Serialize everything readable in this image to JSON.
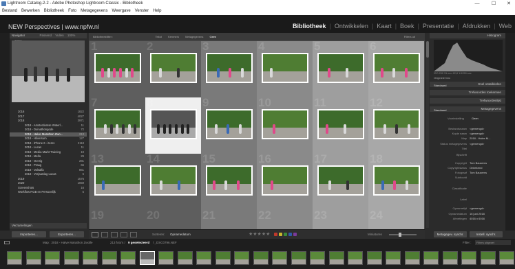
{
  "window": {
    "title": "Lightroom Catalog-2-2 - Adobe Photoshop Lightroom Classic - Bibliotheek",
    "minimize": "—",
    "maximize": "☐",
    "close": "✕"
  },
  "menu": [
    "Bestand",
    "Bewerken",
    "Bibliotheek",
    "Foto",
    "Metagegevens",
    "Weergave",
    "Venster",
    "Help"
  ],
  "identity_plate": "NEW Perspectives | www.npfw.nl",
  "modules": [
    {
      "label": "Bibliotheek",
      "selected": true
    },
    {
      "label": "Ontwikkelen",
      "selected": false
    },
    {
      "label": "Kaart",
      "selected": false
    },
    {
      "label": "Boek",
      "selected": false
    },
    {
      "label": "Presentatie",
      "selected": false
    },
    {
      "label": "Afdrukken",
      "selected": false
    },
    {
      "label": "Web",
      "selected": false
    }
  ],
  "left_panel": {
    "navigator": {
      "title": "Navigator",
      "zoom": [
        "Passend",
        "Vullen",
        "100%",
        "300%"
      ]
    },
    "folders": [
      {
        "label": "2016",
        "count": "1822"
      },
      {
        "label": "2017",
        "count": "4027"
      },
      {
        "label": "2018",
        "count": "3971"
      },
      {
        "label": "2018 - Amsterdamse Waterl...",
        "count": "11"
      },
      {
        "label": "2018 - Duinathongode",
        "count": "72"
      },
      {
        "label": "2018 - Halve Marathon Zwo...",
        "count": "213",
        "selected": true
      },
      {
        "label": "2018 - Hilversum",
        "count": "127"
      },
      {
        "label": "2018 - iPhone 6 - items",
        "count": "2118"
      },
      {
        "label": "2018 - Lucas",
        "count": "11"
      },
      {
        "label": "2018 - Media Markt Training",
        "count": "19"
      },
      {
        "label": "2018 - Mella",
        "count": "29"
      },
      {
        "label": "2018 - Overig",
        "count": "281"
      },
      {
        "label": "2018 - Praag",
        "count": "66"
      },
      {
        "label": "2018 - Valsalfa",
        "count": "861"
      },
      {
        "label": "2018 - Verjaardag Lucas",
        "count": "6"
      },
      {
        "label": "2019",
        "count": "1576"
      },
      {
        "label": "2020",
        "count": "1059"
      },
      {
        "label": "Screenshots",
        "count": "16"
      },
      {
        "label": "Workflow RGB en Persoonlijk",
        "count": "5"
      }
    ],
    "collections_header": "Verzamelingen",
    "import_button": "Importeren...",
    "export_button": "Exporteren..."
  },
  "filter_bar": {
    "label": "Bibliotheekfilter :",
    "tabs": [
      "Tekst",
      "Kenmerk",
      "Metagegevens",
      "Geen"
    ],
    "preset": "Filters uit"
  },
  "grid": {
    "cells": [
      {
        "n": "1"
      },
      {
        "n": "2"
      },
      {
        "n": "3"
      },
      {
        "n": "4"
      },
      {
        "n": "5"
      },
      {
        "n": "6"
      },
      {
        "n": "7"
      },
      {
        "n": "8"
      },
      {
        "n": "9"
      },
      {
        "n": "10"
      },
      {
        "n": "11"
      },
      {
        "n": "12"
      },
      {
        "n": "13"
      },
      {
        "n": "14"
      },
      {
        "n": "15"
      },
      {
        "n": "16"
      },
      {
        "n": "17"
      },
      {
        "n": "18"
      },
      {
        "n": "19"
      },
      {
        "n": "20"
      },
      {
        "n": "21"
      },
      {
        "n": "22"
      },
      {
        "n": "23"
      },
      {
        "n": "24"
      }
    ]
  },
  "toolbar": {
    "sort_label": "Sorteren:",
    "sort_value": "Opnamedatum",
    "stars": "★★★★★",
    "thumbnails_label": "Miniaturen"
  },
  "right_panel": {
    "histogram_title": "Histogram",
    "histogram_info": "ISO 200   31 mm   f/2,8   1/1250 sec",
    "original_photo": "Originele foto",
    "quick_develop": "Snel ontwikkelen",
    "saved_preset": "Standaard",
    "keywording": "Trefwoorden toekennen",
    "keyword_list": "Trefwoordenlijst",
    "metadata_title": "Metagegevens",
    "metadata_preset": "Standaard",
    "preset_label": "Voorinstelling",
    "preset_value": "Geen",
    "fields": [
      {
        "label": "Bestandsnaam",
        "value": "<gemengd>"
      },
      {
        "label": "Kopie naam",
        "value": "<gemengd>"
      },
      {
        "label": "Map",
        "value": "2018 - Halve M..."
      },
      {
        "label": "Status metagegevens",
        "value": "<gemengd>"
      },
      {
        "label": "Titel",
        "value": ""
      },
      {
        "label": "Bijschrift",
        "value": ""
      },
      {
        "label": "Copyright",
        "value": "Tom Bauwens"
      },
      {
        "label": "Copyrightstatus",
        "value": "Onbekend"
      },
      {
        "label": "Fotograaf",
        "value": "Tom Bauwens"
      },
      {
        "label": "Subhoofd",
        "value": ""
      },
      {
        "label": "Classificatie",
        "value": ""
      },
      {
        "label": "Label",
        "value": ""
      },
      {
        "label": "Opnametijd",
        "value": "<gemengd>"
      },
      {
        "label": "Opnamedatum",
        "value": "16 juni 2018"
      },
      {
        "label": "Afmetingen",
        "value": "4016 x 6016"
      }
    ],
    "sync_button": "Metagegev. synchr.",
    "sync_settings_button": "Instell. synchr."
  },
  "bottom_bar": {
    "path": "Map : 2018 - Halve Marathon Zwolle",
    "count": "213 foto's /",
    "selected": "9 geselecteerd",
    "file": "/ _DSC0796.NEF",
    "filter_label": "Filter :",
    "filter_value": "Filters uitgezet"
  },
  "filmstrip": {
    "count": 27,
    "selected_index": 7
  },
  "colors": {
    "accent": "#ffffff",
    "red": "#c0392b",
    "yellow": "#c8b830",
    "green": "#3a8a3a",
    "blue": "#2f5aa8",
    "purple": "#7a3a9a"
  }
}
